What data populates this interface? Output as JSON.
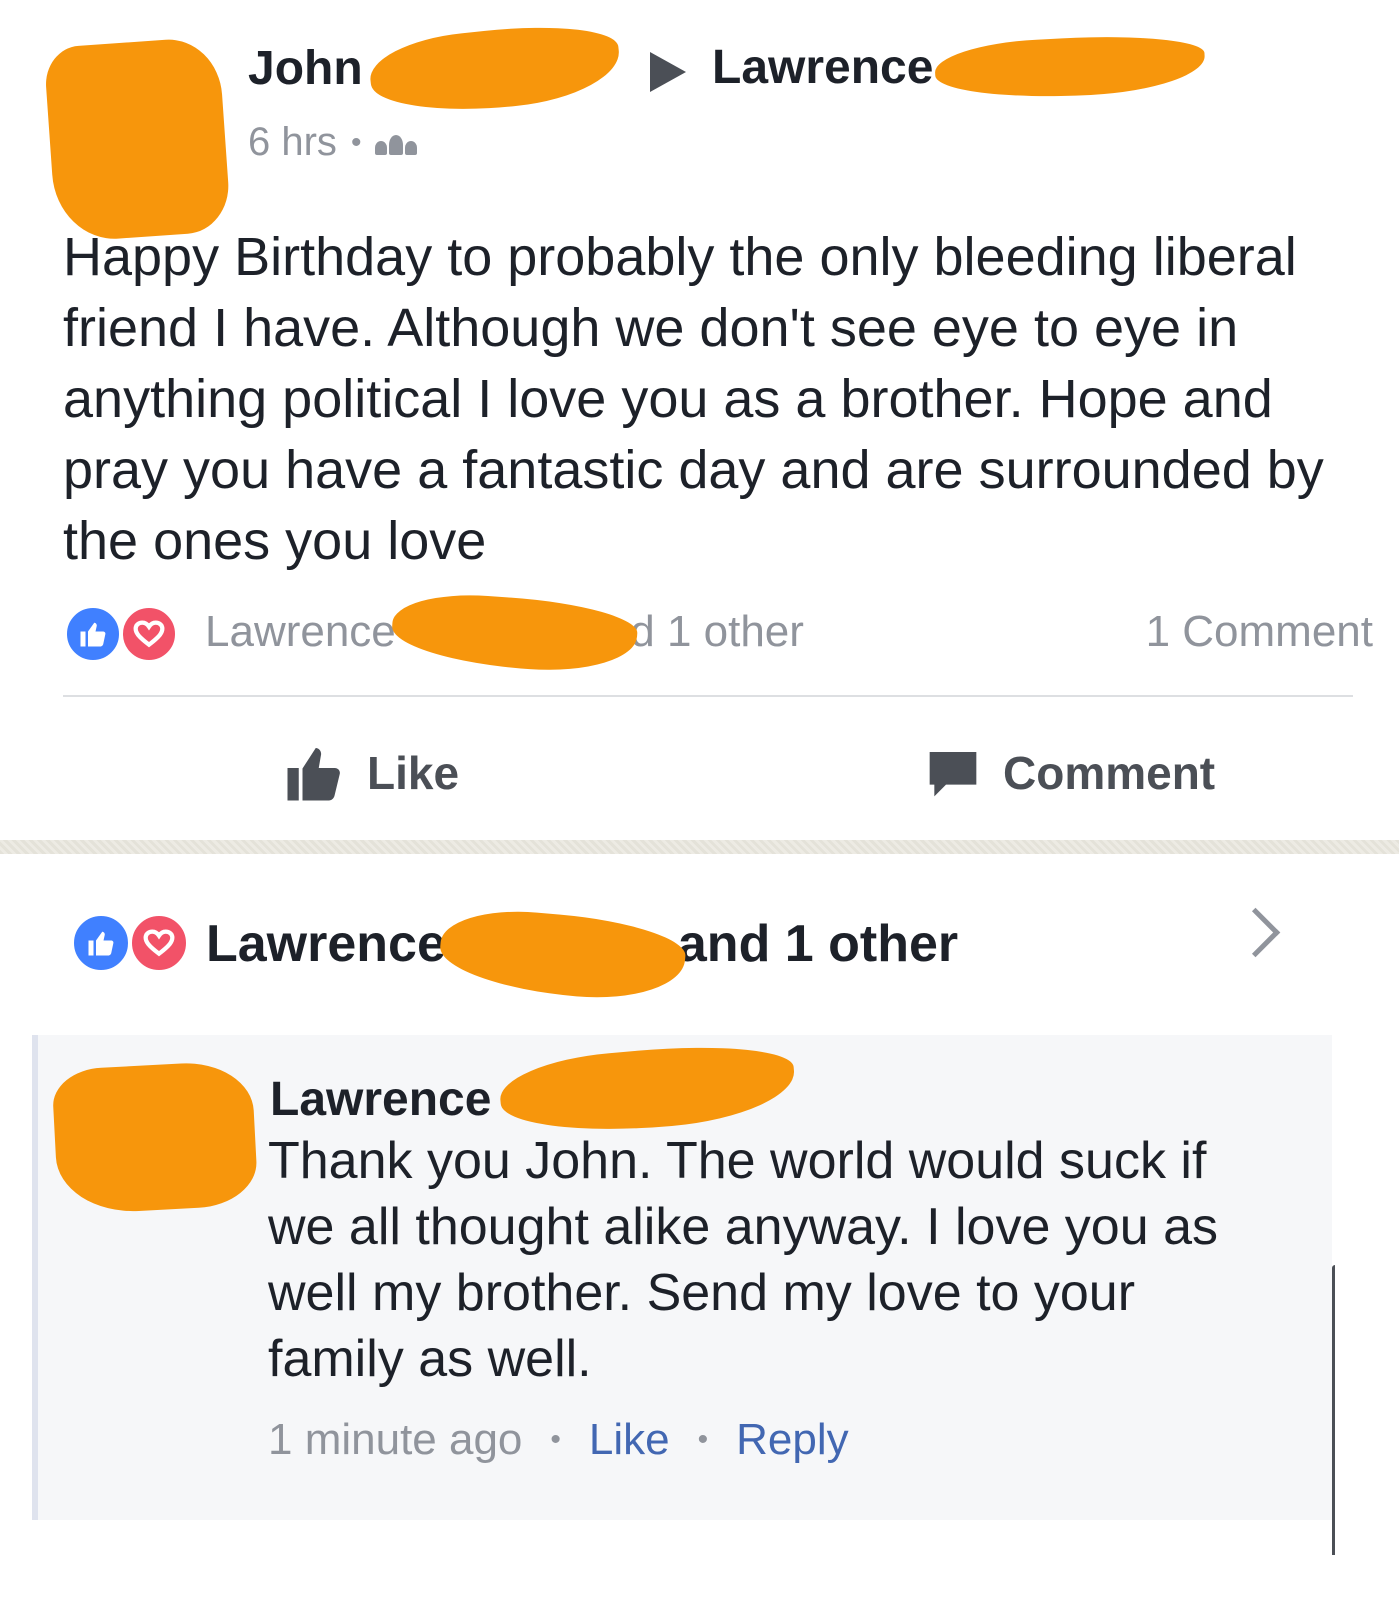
{
  "post": {
    "author_first_name": "John",
    "target_first_name": "Lawrence",
    "time": "6 hrs",
    "separator": "•",
    "audience_icon": "friends-icon",
    "text": "Happy Birthday to probably the only bleeding liberal friend I have. Although we don't see eye to eye in anything political I love you as a brother. Hope and pray you have a fantastic day and are surrounded by the ones you love",
    "reactions": {
      "icons": [
        "like-icon",
        "love-icon"
      ],
      "names_visible": "Lawrence",
      "names_suffix": "nd 1 other",
      "comment_count": "1 Comment"
    },
    "actions": {
      "like_label": "Like",
      "comment_label": "Comment"
    }
  },
  "comments": {
    "likers": {
      "first_name": "Lawrence",
      "suffix": "and 1 other"
    },
    "reply": {
      "author_first_name": "Lawrence",
      "text": "Thank you John.  The world would suck if we all thought alike anyway.  I love you as well my brother.  Send my love to your family as well.",
      "time": "1 minute ago",
      "separator": "•",
      "like_label": "Like",
      "reply_label": "Reply"
    }
  },
  "colors": {
    "redaction": "#f7960c",
    "text_primary": "#1d2129",
    "text_secondary": "#90949c",
    "link_blue": "#4267b2",
    "like_blue": "#4080ff",
    "love_red": "#f25268"
  }
}
